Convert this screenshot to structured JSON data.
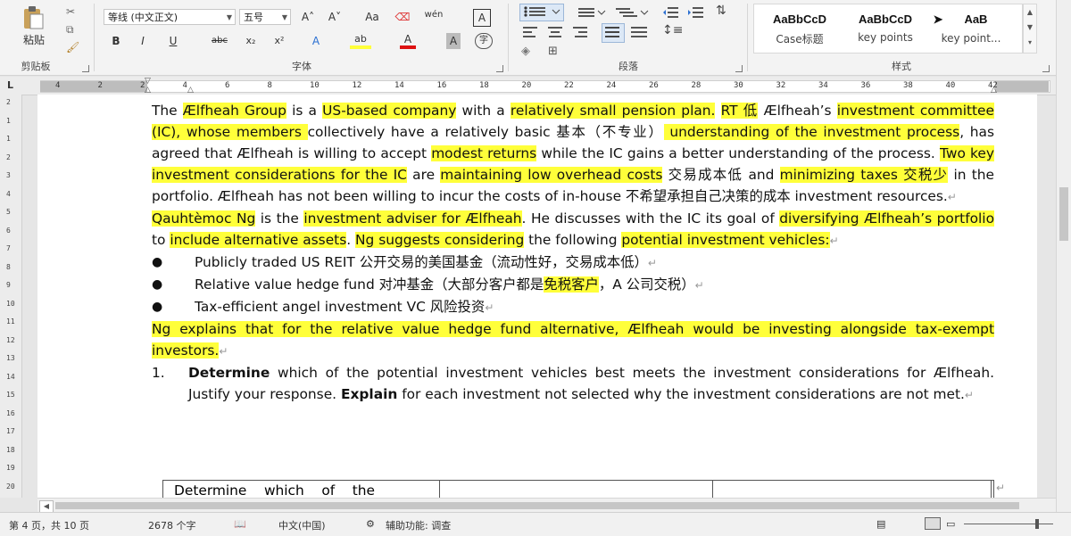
{
  "ribbon": {
    "clipboard": {
      "paste_label": "粘贴",
      "group_label": "剪贴板"
    },
    "font": {
      "font_name": "等线 (中文正文)",
      "font_size": "五号",
      "grow_label": "A˄",
      "shrink_label": "A˅",
      "case_label": "Aa",
      "phonetic_label": "wén",
      "charborder_label": "A",
      "bold_label": "B",
      "italic_label": "I",
      "underline_label": "U",
      "strike_label": "abc",
      "sub_label": "x₂",
      "sup_label": "x²",
      "effects_label": "A",
      "highlight_label": "ab",
      "color_label": "A",
      "shade_label": "A",
      "enclose_label": "字",
      "group_label": "字体"
    },
    "paragraph": {
      "group_label": "段落"
    },
    "styles": {
      "items": [
        {
          "sample": "AaBbCcD",
          "name": "Case标题"
        },
        {
          "sample": "AaBbCcD",
          "name": "key points"
        },
        {
          "sample": "AaB",
          "name": "key point..."
        }
      ],
      "group_label": "样式"
    }
  },
  "ruler": {
    "tab_selector": "L",
    "numbers": [
      "4",
      "2",
      "2",
      "4",
      "6",
      "8",
      "10",
      "12",
      "14",
      "16",
      "18",
      "20",
      "22",
      "24",
      "26",
      "28",
      "30",
      "32",
      "34",
      "36",
      "38",
      "40",
      "42"
    ]
  },
  "vruler": {
    "numbers": [
      "2",
      "1",
      "1",
      "2",
      "3",
      "4",
      "5",
      "6",
      "7",
      "8",
      "9",
      "10",
      "11",
      "12",
      "13",
      "14",
      "15",
      "16",
      "17",
      "18",
      "19",
      "20"
    ]
  },
  "doc": {
    "p1": [
      "The ",
      "Ælfheah Group",
      " is a ",
      "US-based company",
      " with a ",
      "relatively small pension plan.",
      " ",
      "RT 低",
      " Ælfheah’s ",
      "investment committee (IC),",
      " whose members ",
      "collectively have a relatively basic 基本（不专业）",
      " ",
      "understanding of the investment process",
      ", has agreed that Ælfheah is willing to accept ",
      "modest returns",
      " while the IC gains a better understanding of the process. ",
      "Two key investment considerations for the IC",
      " are ",
      "maintaining low overhead costs",
      " 交易成本低 and ",
      "minimizing taxes 交税少",
      " in the portfolio. ",
      "Ælfheah has not been willing to incur the costs of in-house 不希望承担自己决策的成本 investment resources."
    ],
    "p2": [
      "Qauhtèmoc Ng",
      " is the ",
      "investment adviser for Ælfheah",
      ". He discusses with the IC its goal of ",
      "diversifying Ælfheah’s portfolio",
      " to ",
      "include alternative assets",
      ". ",
      "Ng suggests considering",
      " the following ",
      "potential investment vehicles:"
    ],
    "bullets": [
      "Publicly traded US REIT 公开交易的美国基金（流动性好，交易成本低）",
      [
        "Relative value hedge fund 对冲基金（大部分客户都是",
        "免税客户",
        "，A 公司交税）"
      ],
      "Tax-efficient angel investment VC 风险投资"
    ],
    "p3": "Ng explains that for the relative value hedge fund alternative, Ælfheah would be investing alongside tax-exempt investors.",
    "q_num": "1.",
    "q_text": [
      "Determine",
      " which of the potential investment vehicles best meets the investment considerations for Ælfheah. Justify your response. ",
      "Explain",
      " for each investment not selected why the investment considerations are not met."
    ],
    "table_cell1": "Determine    which    of    the"
  },
  "status": {
    "page": "第 4 页，共 10 页",
    "words": "2678 个字",
    "language": "中文(中国)",
    "accessibility": "辅助功能: 调查"
  },
  "colors": {
    "highlight": "#ffff3a",
    "ribbon_bg": "#f3f3f3",
    "page_bg": "#ffffff"
  }
}
